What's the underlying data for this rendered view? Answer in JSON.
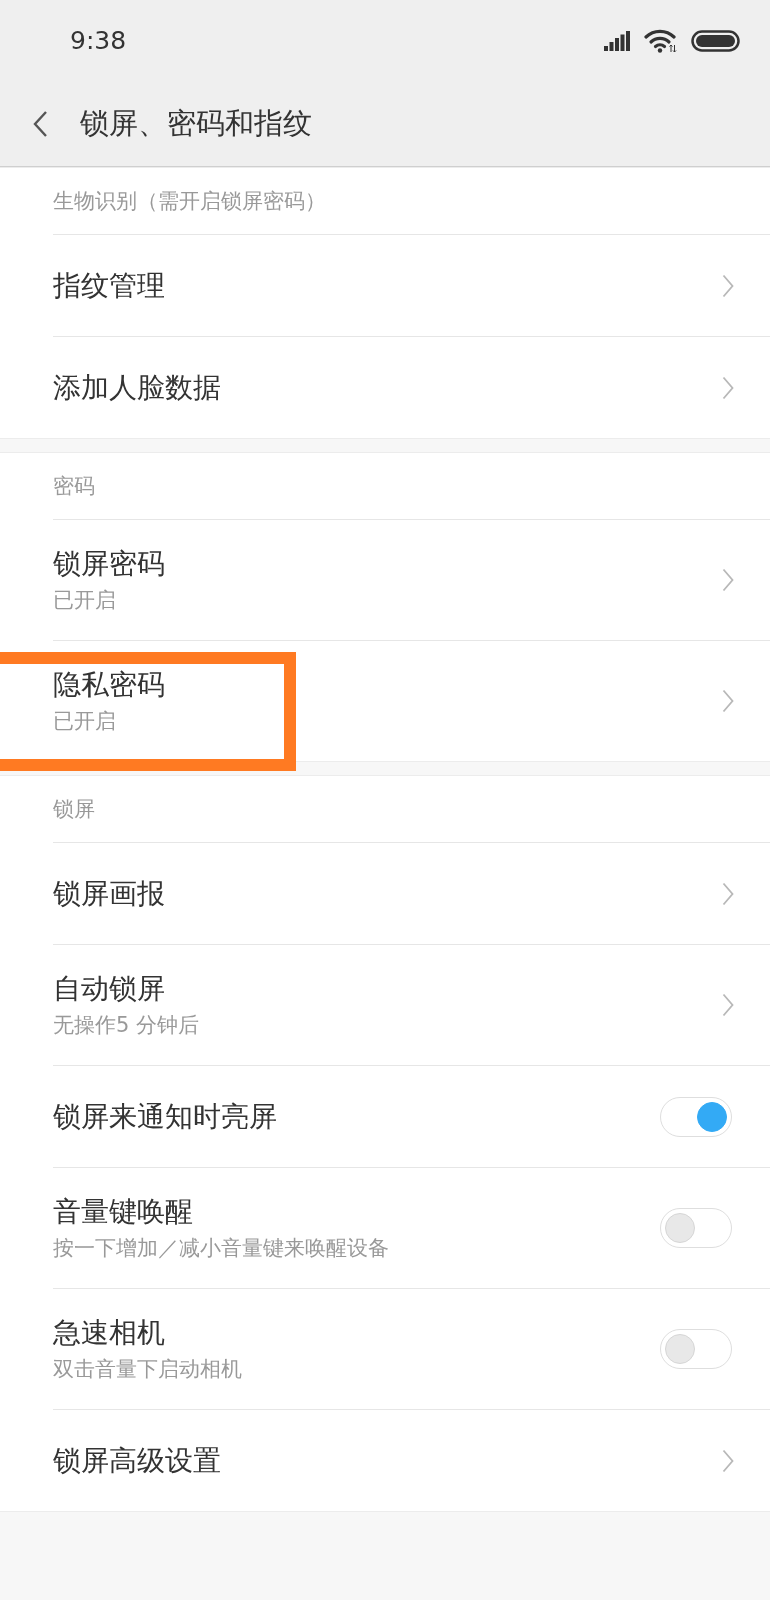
{
  "status_bar": {
    "time": "9:38"
  },
  "header": {
    "title": "锁屏、密码和指纹"
  },
  "sections": [
    {
      "title": "生物识别（需开启锁屏密码）",
      "items": [
        {
          "kind": "link",
          "label": "指纹管理",
          "highlighted": false
        },
        {
          "kind": "link",
          "label": "添加人脸数据",
          "highlighted": false
        }
      ]
    },
    {
      "title": "密码",
      "items": [
        {
          "kind": "link",
          "label": "锁屏密码",
          "status": "已开启",
          "highlighted": false
        },
        {
          "kind": "link",
          "label": "隐私密码",
          "status": "已开启",
          "highlighted": true
        }
      ]
    },
    {
      "title": "锁屏",
      "items": [
        {
          "kind": "link",
          "label": "锁屏画报",
          "highlighted": false
        },
        {
          "kind": "link",
          "label": "自动锁屏",
          "status": "无操作5 分钟后",
          "highlighted": false
        },
        {
          "kind": "toggle",
          "label": "锁屏来通知时亮屏",
          "on": true,
          "highlighted": false
        },
        {
          "kind": "toggle",
          "label": "音量键唤醒",
          "status": "按一下增加／减小音量键来唤醒设备",
          "on": false,
          "highlighted": false
        },
        {
          "kind": "toggle",
          "label": "急速相机",
          "status": "双击音量下启动相机",
          "on": false,
          "highlighted": false
        },
        {
          "kind": "link",
          "label": "锁屏高级设置",
          "highlighted": false
        }
      ]
    }
  ]
}
